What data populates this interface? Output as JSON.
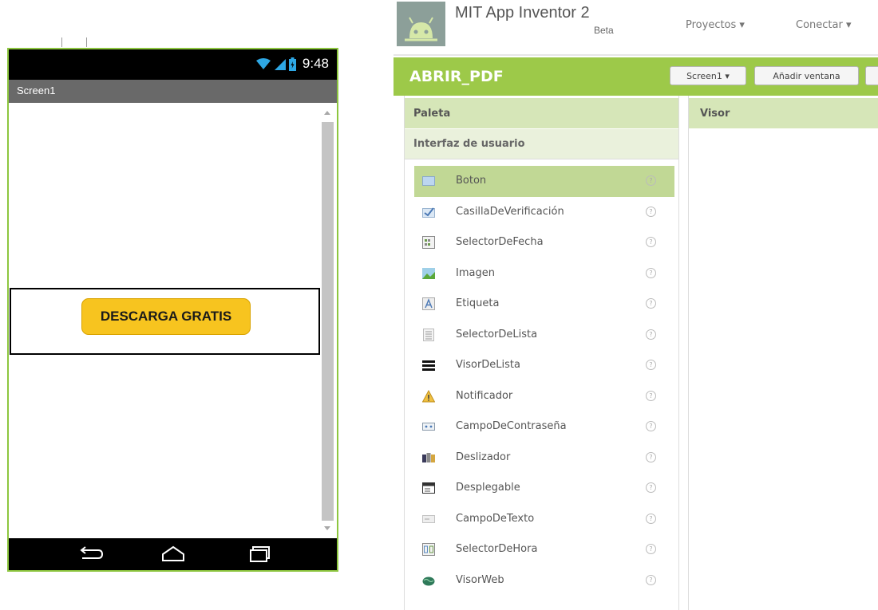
{
  "phone": {
    "status": {
      "time": "9:48"
    },
    "title": "Screen1",
    "button_label": "DESCARGA GRATIS"
  },
  "app": {
    "name": "MIT App Inventor 2",
    "badge": "Beta",
    "menu": [
      "Proyectos ▾",
      "Conectar ▾"
    ]
  },
  "project": {
    "name": "ABRIR_PDF",
    "screen_selector": "Screen1 ▾",
    "add_screen": "Añadir ventana"
  },
  "palette": {
    "header": "Paleta",
    "category": "Interfaz de usuario",
    "help_glyph": "?",
    "items": [
      {
        "label": "Boton",
        "icon": "button-icon"
      },
      {
        "label": "CasillaDeVerificación",
        "icon": "checkbox-icon"
      },
      {
        "label": "SelectorDeFecha",
        "icon": "date-picker-icon"
      },
      {
        "label": "Imagen",
        "icon": "image-icon"
      },
      {
        "label": "Etiqueta",
        "icon": "label-icon"
      },
      {
        "label": "SelectorDeLista",
        "icon": "list-picker-icon"
      },
      {
        "label": "VisorDeLista",
        "icon": "list-view-icon"
      },
      {
        "label": "Notificador",
        "icon": "notifier-icon"
      },
      {
        "label": "CampoDeContraseña",
        "icon": "password-field-icon"
      },
      {
        "label": "Deslizador",
        "icon": "slider-icon"
      },
      {
        "label": "Desplegable",
        "icon": "spinner-icon"
      },
      {
        "label": "CampoDeTexto",
        "icon": "textbox-icon"
      },
      {
        "label": "SelectorDeHora",
        "icon": "time-picker-icon"
      },
      {
        "label": "VisorWeb",
        "icon": "web-viewer-icon"
      }
    ]
  },
  "viewer": {
    "header": "Visor"
  },
  "colors": {
    "accent_green": "#9dc949",
    "header_green": "#d6e6b8",
    "selected_green": "#c1d895",
    "button_yellow": "#f7c41f"
  }
}
